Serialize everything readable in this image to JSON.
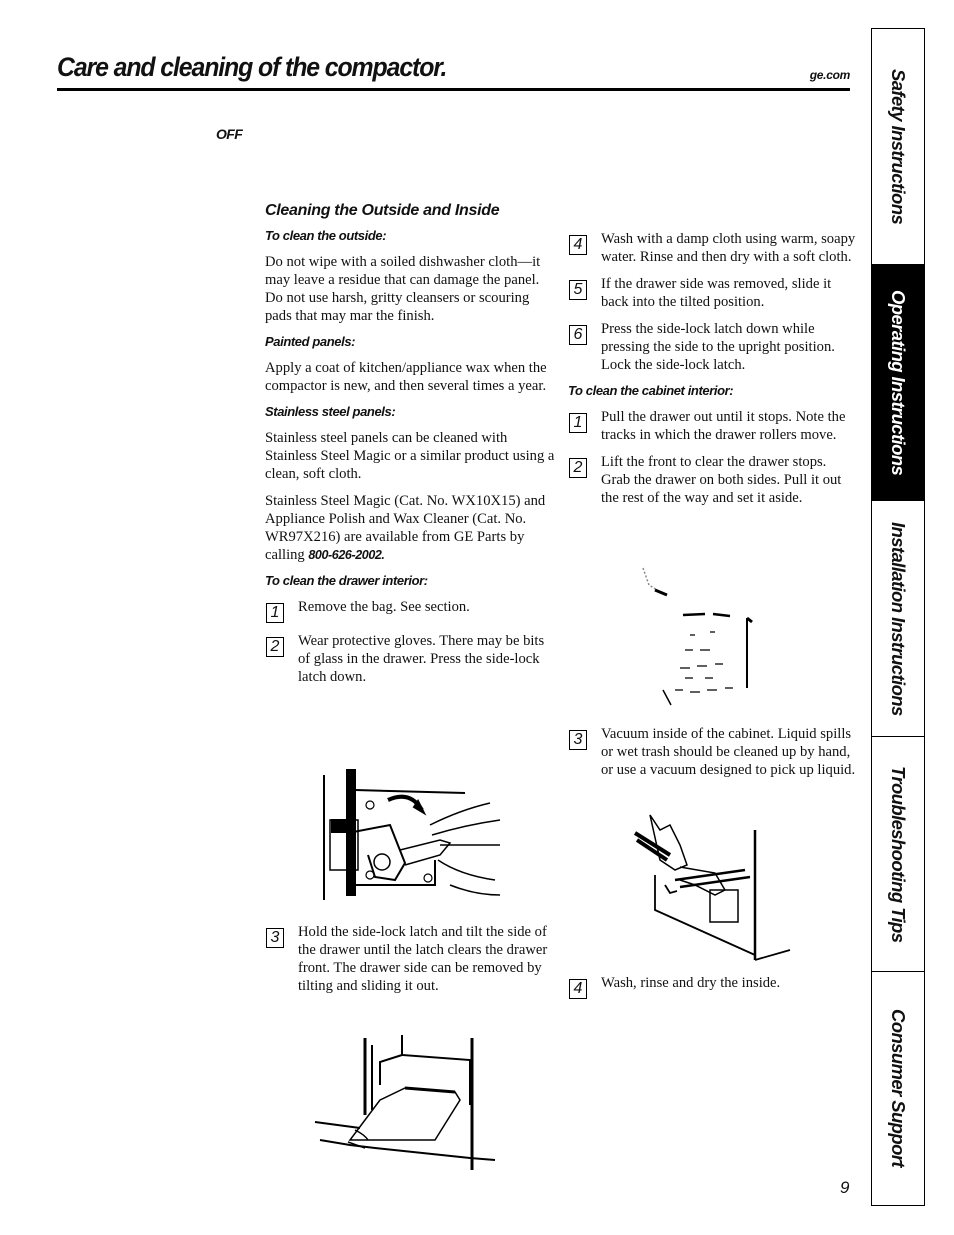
{
  "header": {
    "title": "Care and cleaning of the compactor.",
    "site": "ge.com",
    "off_label": "OFF"
  },
  "section": {
    "heading": "Cleaning the Outside and Inside",
    "outside": {
      "heading": "To clean the outside:",
      "text": "Do not wipe with a soiled dishwasher cloth—it may leave a residue that can damage the panel. Do not use harsh, gritty cleansers or scouring pads that may mar the finish."
    },
    "painted": {
      "heading": "Painted panels:",
      "text": "Apply a coat of kitchen/appliance wax when the compactor is new, and then several times a year."
    },
    "stainless": {
      "heading": "Stainless steel panels:",
      "text1": "Stainless steel panels can be cleaned with Stainless Steel Magic or a similar product using a clean, soft cloth.",
      "text2": "Stainless Steel Magic (Cat. No. WX10X15) and Appliance Polish and Wax Cleaner (Cat. No. WR97X216) are available from GE Parts by calling",
      "phone": "800-626-2002."
    },
    "drawer_interior": {
      "heading": "To clean the drawer interior:",
      "steps": [
        {
          "num": "1",
          "text": "Remove the bag. See section."
        },
        {
          "num": "2",
          "text": "Wear protective gloves. There may be bits of glass in the drawer. Press the side-lock latch down."
        },
        {
          "num": "3",
          "text": "Hold the side-lock latch and tilt the side of the drawer until the latch clears the drawer front. The drawer side can be removed by tilting and sliding it out."
        },
        {
          "num": "4",
          "text": "Wash with a damp cloth using warm, soapy water. Rinse and then dry with a soft cloth."
        },
        {
          "num": "5",
          "text": "If the drawer side was removed, slide it back into the tilted position."
        },
        {
          "num": "6",
          "text": "Press the side-lock latch down while pressing the side to the upright position. Lock the side-lock latch."
        }
      ]
    },
    "cabinet_interior": {
      "heading": "To clean the cabinet interior:",
      "steps": [
        {
          "num": "1",
          "text": "Pull the drawer out until it stops. Note the tracks in which the drawer rollers move."
        },
        {
          "num": "2",
          "text": "Lift the front to clear the drawer stops. Grab the drawer on both sides. Pull it out the rest of the way and set it aside."
        },
        {
          "num": "3",
          "text": "Vacuum inside of the cabinet. Liquid spills or wet trash should be cleaned up by hand, or use a vacuum designed to pick up liquid."
        },
        {
          "num": "4",
          "text": "Wash, rinse and dry the inside."
        }
      ]
    }
  },
  "side_tabs": [
    {
      "label": "Safety Instructions",
      "active": false
    },
    {
      "label": "Operating Instructions",
      "active": true
    },
    {
      "label": "Installation Instructions",
      "active": false
    },
    {
      "label": "Troubleshooting Tips",
      "active": false
    },
    {
      "label": "Consumer Support",
      "active": false
    }
  ],
  "page_number": "9"
}
